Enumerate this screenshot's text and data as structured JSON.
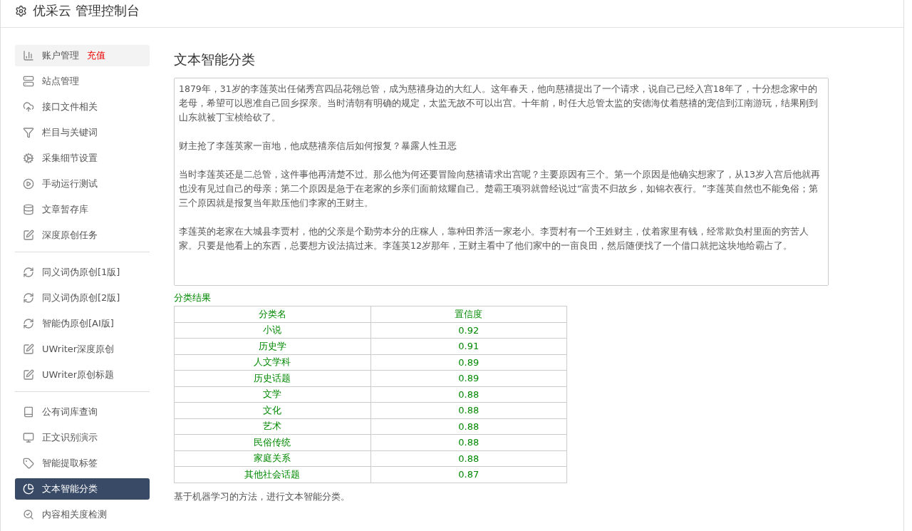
{
  "header": {
    "title": "优采云 管理控制台"
  },
  "sidebar": {
    "groups": [
      {
        "items": [
          {
            "label": "账户管理",
            "badge": "充值",
            "selected": false
          },
          {
            "label": "站点管理",
            "selected": false
          },
          {
            "label": "接口文件相关",
            "selected": false
          },
          {
            "label": "栏目与关键词",
            "selected": false
          },
          {
            "label": "采集细节设置",
            "selected": false
          },
          {
            "label": "手动运行测试",
            "selected": false
          },
          {
            "label": "文章暂存库",
            "selected": false
          },
          {
            "label": "深度原创任务",
            "selected": false
          }
        ]
      },
      {
        "items": [
          {
            "label": "同义词伪原创[1版]",
            "selected": false
          },
          {
            "label": "同义词伪原创[2版]",
            "selected": false
          },
          {
            "label": "智能伪原创[AI版]",
            "selected": false
          },
          {
            "label": "UWriter深度原创",
            "selected": false
          },
          {
            "label": "UWriter原创标题",
            "selected": false
          }
        ]
      },
      {
        "items": [
          {
            "label": "公有词库查询",
            "selected": false
          },
          {
            "label": "正文识别演示",
            "selected": false
          },
          {
            "label": "智能提取标签",
            "selected": false
          },
          {
            "label": "文本智能分类",
            "selected": true
          },
          {
            "label": "内容相关度检测",
            "selected": false
          }
        ]
      }
    ]
  },
  "content": {
    "title": "文本智能分类",
    "input_paragraphs": [
      "1879年，31岁的李莲英出任储秀宫四品花翎总管，成为慈禧身边的大红人。这年春天，他向慈禧提出了一个请求，说自己已经入宫18年了，十分想念家中的老母，希望可以恩准自己回乡探亲。当时清朝有明确的规定，太监无故不可以出宫。十年前，时任大总管太监的安德海仗着慈禧的宠信到江南游玩，结果刚到山东就被丁宝桢给砍了。",
      "财主抢了李莲英家一亩地，他成慈禧亲信后如何报复？暴露人性丑恶",
      "当时李莲英还是二总管，这件事他再清楚不过。那么他为何还要冒险向慈禧请求出宫呢？主要原因有三个。第一个原因是他确实想家了，从13岁入宫后他就再也没有见过自己的母亲；第二个原因是急于在老家的乡亲们面前炫耀自己。楚霸王项羽就曾经说过“富贵不归故乡，如锦衣夜行。”李莲英自然也不能免俗；第三个原因就是报复当年欺压他们李家的王财主。",
      "李莲英的老家在大城县李贾村，他的父亲是个勤劳本分的庄稼人，靠种田养活一家老小。李贾村有一个王姓财主，仗着家里有钱，经常欺负村里面的穷苦人家。只要是他看上的东西，总要想方设法搞过来。李莲英12岁那年，王财主看中了他们家中的一亩良田，然后随便找了一个借口就把这块地给霸占了。"
    ],
    "result_label": "分类结果",
    "table": {
      "columns": [
        "分类名",
        "置信度"
      ],
      "rows": [
        [
          "小说",
          "0.92"
        ],
        [
          "历史学",
          "0.91"
        ],
        [
          "人文学科",
          "0.89"
        ],
        [
          "历史话题",
          "0.89"
        ],
        [
          "文学",
          "0.88"
        ],
        [
          "文化",
          "0.88"
        ],
        [
          "艺术",
          "0.88"
        ],
        [
          "民俗传统",
          "0.88"
        ],
        [
          "家庭关系",
          "0.88"
        ],
        [
          "其他社会话题",
          "0.87"
        ]
      ]
    },
    "note": "基于机器学习的方法，进行文本智能分类。"
  }
}
